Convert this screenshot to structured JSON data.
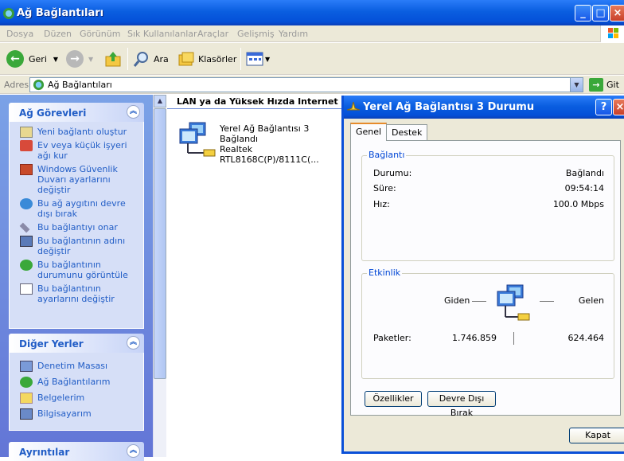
{
  "window": {
    "title": "Ağ Bağlantıları"
  },
  "menu": [
    "Dosya",
    "Düzen",
    "Görünüm",
    "Sık Kullanılanlar",
    "Araçlar",
    "Gelişmiş",
    "Yardım"
  ],
  "toolbar": {
    "back": "Geri",
    "search": "Ara",
    "folders": "Klasörler"
  },
  "address": {
    "label": "Adres",
    "value": "Ağ Bağlantıları",
    "go": "Git"
  },
  "tasks": {
    "title": "Ağ Görevleri",
    "items": [
      "Yeni bağlantı oluştur",
      "Ev veya küçük işyeri ağı kur",
      "Windows Güvenlik Duvarı ayarlarını değiştir",
      "Bu ağ aygıtını devre dışı bırak",
      "Bu bağlantıyı onar",
      "Bu bağlantının adını değiştir",
      "Bu bağlantının durumunu görüntüle",
      "Bu bağlantının ayarlarını değiştir"
    ]
  },
  "other_places": {
    "title": "Diğer Yerler",
    "items": [
      "Denetim Masası",
      "Ağ Bağlantılarım",
      "Belgelerim",
      "Bilgisayarım"
    ]
  },
  "details": {
    "title": "Ayrıntılar"
  },
  "group": {
    "title": "LAN ya da Yüksek Hızda Internet"
  },
  "connection": {
    "name": "Yerel Ağ Bağlantısı 3",
    "status": "Bağlandı",
    "device": "Realtek RTL8168C(P)/8111C(..."
  },
  "dialog": {
    "title": "Yerel Ağ Bağlantısı 3 Durumu",
    "tabs": [
      "Genel",
      "Destek"
    ],
    "connection_group": "Bağlantı",
    "status_label": "Durumu:",
    "status_value": "Bağlandı",
    "duration_label": "Süre:",
    "duration_value": "09:54:14",
    "speed_label": "Hız:",
    "speed_value": "100.0 Mbps",
    "activity_group": "Etkinlik",
    "sent_label": "Giden",
    "received_label": "Gelen",
    "packets_label": "Paketler:",
    "packets_sent": "1.746.859",
    "packets_received": "624.464",
    "properties_button": "Özellikler",
    "disable_button": "Devre Dışı Bırak",
    "close_button": "Kapat"
  },
  "colors": {
    "xp_blue": "#0a5ee0",
    "task_link": "#215dc6",
    "group_legend": "#0046d5"
  }
}
